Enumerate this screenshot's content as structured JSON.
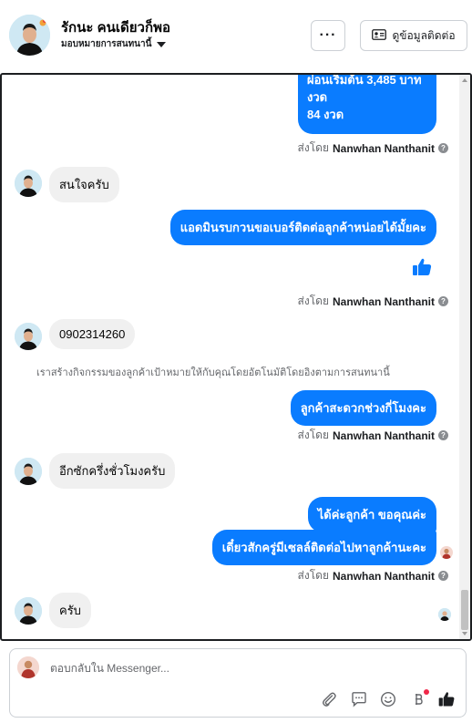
{
  "header": {
    "contact_name": "รักนะ คนเดียวก็พอ",
    "assign_label": "มอบหมายการสนทนานี้",
    "more_label": "···",
    "contact_info_label": "ดูข้อมูลติดต่อ"
  },
  "messages": {
    "m1_line1": "ผ่อนเริ่มต้น 3,485 บาท",
    "m1_line2": "งวด",
    "m1_line3": "84 งวด",
    "sent_by_prefix": "ส่งโดย",
    "agent_name": "Nanwhan Nanthanit",
    "m2": "สนใจครับ",
    "m3": "แอดมินรบกวนขอเบอร์ติดต่อลูกค้าหน่อยได้มั้ยคะ",
    "m4": "0902314260",
    "system_note": "เราสร้างกิจกรรมของลูกค้าเป้าหมายให้กับคุณโดยอัตโนมัติโดยอิงตามการสนทนานี้",
    "m5": "ลูกค้าสะดวกช่วงกี่โมงคะ",
    "m6": "อีกซักครึ่งชั่วโมงครับ",
    "m7": "ได้ค่ะลูกค้า ขอคุณค่ะ",
    "m8": "เดี๋ยวสักครู่มีเซลล์ติดต่อไปหาลูกค้านะคะ",
    "m9": "ครับ"
  },
  "composer": {
    "placeholder": "ตอบกลับใน Messenger..."
  },
  "colors": {
    "accent": "#0a7cff",
    "incoming_bubble": "#f0f0f0"
  },
  "icons": [
    "profile-avatar",
    "more-dots-icon",
    "contact-card-icon",
    "thumbs-up-icon",
    "help-icon",
    "attach-icon",
    "saved-reply-icon",
    "emoji-icon",
    "payment-icon",
    "like-send-icon"
  ]
}
